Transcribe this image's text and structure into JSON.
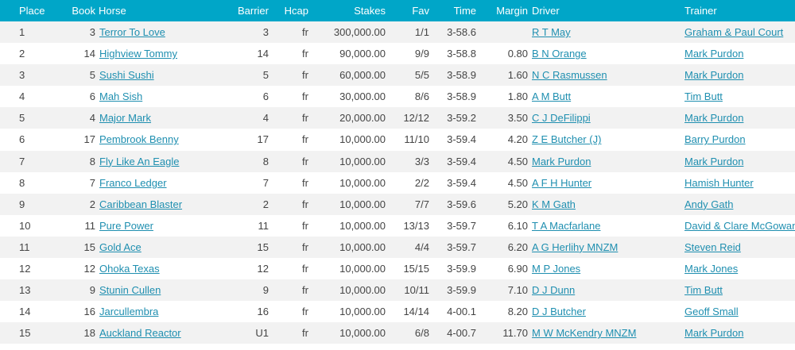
{
  "columns": {
    "place": "Place",
    "book": "Book",
    "horse": "Horse",
    "barrier": "Barrier",
    "hcap": "Hcap",
    "stakes": "Stakes",
    "fav": "Fav",
    "time": "Time",
    "margin": "Margin",
    "driver": "Driver",
    "trainer": "Trainer"
  },
  "rows": [
    {
      "place": "1",
      "book": "3",
      "horse": "Terror To Love",
      "barrier": "3",
      "hcap": "fr",
      "stakes": "300,000.00",
      "fav": "1/1",
      "time": "3-58.6",
      "margin": "",
      "driver": "R T May",
      "trainer": "Graham & Paul Court"
    },
    {
      "place": "2",
      "book": "14",
      "horse": "Highview Tommy",
      "barrier": "14",
      "hcap": "fr",
      "stakes": "90,000.00",
      "fav": "9/9",
      "time": "3-58.8",
      "margin": "0.80",
      "driver": "B N Orange",
      "trainer": "Mark Purdon"
    },
    {
      "place": "3",
      "book": "5",
      "horse": "Sushi Sushi",
      "barrier": "5",
      "hcap": "fr",
      "stakes": "60,000.00",
      "fav": "5/5",
      "time": "3-58.9",
      "margin": "1.60",
      "driver": "N C Rasmussen",
      "trainer": "Mark Purdon"
    },
    {
      "place": "4",
      "book": "6",
      "horse": "Mah Sish",
      "barrier": "6",
      "hcap": "fr",
      "stakes": "30,000.00",
      "fav": "8/6",
      "time": "3-58.9",
      "margin": "1.80",
      "driver": "A M Butt",
      "trainer": "Tim Butt"
    },
    {
      "place": "5",
      "book": "4",
      "horse": "Major Mark",
      "barrier": "4",
      "hcap": "fr",
      "stakes": "20,000.00",
      "fav": "12/12",
      "time": "3-59.2",
      "margin": "3.50",
      "driver": "C J DeFilippi",
      "trainer": "Mark Purdon"
    },
    {
      "place": "6",
      "book": "17",
      "horse": "Pembrook Benny",
      "barrier": "17",
      "hcap": "fr",
      "stakes": "10,000.00",
      "fav": "11/10",
      "time": "3-59.4",
      "margin": "4.20",
      "driver": "Z E Butcher (J)",
      "trainer": "Barry Purdon"
    },
    {
      "place": "7",
      "book": "8",
      "horse": "Fly Like An Eagle",
      "barrier": "8",
      "hcap": "fr",
      "stakes": "10,000.00",
      "fav": "3/3",
      "time": "3-59.4",
      "margin": "4.50",
      "driver": "Mark Purdon",
      "trainer": "Mark Purdon"
    },
    {
      "place": "8",
      "book": "7",
      "horse": "Franco Ledger",
      "barrier": "7",
      "hcap": "fr",
      "stakes": "10,000.00",
      "fav": "2/2",
      "time": "3-59.4",
      "margin": "4.50",
      "driver": "A F H Hunter",
      "trainer": "Hamish Hunter"
    },
    {
      "place": "9",
      "book": "2",
      "horse": "Caribbean Blaster",
      "barrier": "2",
      "hcap": "fr",
      "stakes": "10,000.00",
      "fav": "7/7",
      "time": "3-59.6",
      "margin": "5.20",
      "driver": "K M Gath",
      "trainer": "Andy Gath"
    },
    {
      "place": "10",
      "book": "11",
      "horse": "Pure Power",
      "barrier": "11",
      "hcap": "fr",
      "stakes": "10,000.00",
      "fav": "13/13",
      "time": "3-59.7",
      "margin": "6.10",
      "driver": "T A Macfarlane",
      "trainer": "David & Clare McGowan"
    },
    {
      "place": "11",
      "book": "15",
      "horse": "Gold Ace",
      "barrier": "15",
      "hcap": "fr",
      "stakes": "10,000.00",
      "fav": "4/4",
      "time": "3-59.7",
      "margin": "6.20",
      "driver": "A G Herlihy MNZM",
      "trainer": "Steven Reid"
    },
    {
      "place": "12",
      "book": "12",
      "horse": "Ohoka Texas",
      "barrier": "12",
      "hcap": "fr",
      "stakes": "10,000.00",
      "fav": "15/15",
      "time": "3-59.9",
      "margin": "6.90",
      "driver": "M P Jones",
      "trainer": "Mark Jones"
    },
    {
      "place": "13",
      "book": "9",
      "horse": "Stunin Cullen",
      "barrier": "9",
      "hcap": "fr",
      "stakes": "10,000.00",
      "fav": "10/11",
      "time": "3-59.9",
      "margin": "7.10",
      "driver": "D J Dunn",
      "trainer": "Tim Butt"
    },
    {
      "place": "14",
      "book": "16",
      "horse": "Jarcullembra",
      "barrier": "16",
      "hcap": "fr",
      "stakes": "10,000.00",
      "fav": "14/14",
      "time": "4-00.1",
      "margin": "8.20",
      "driver": "D J Butcher",
      "trainer": "Geoff Small"
    },
    {
      "place": "15",
      "book": "18",
      "horse": "Auckland Reactor",
      "barrier": "U1",
      "hcap": "fr",
      "stakes": "10,000.00",
      "fav": "6/8",
      "time": "4-00.7",
      "margin": "11.70",
      "driver": "M W McKendry MNZM",
      "trainer": "Mark Purdon"
    }
  ]
}
